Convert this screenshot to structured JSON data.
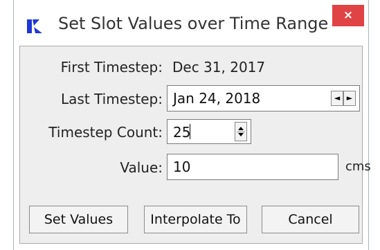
{
  "window": {
    "title": "Set Slot Values over Time Range",
    "close_symbol": "×",
    "icon": "riverware-r-icon",
    "accent_color": "#1f37d6",
    "close_color": "#e04343"
  },
  "form": {
    "first_timestep": {
      "label": "First Timestep:",
      "value": "Dec 31, 2017"
    },
    "last_timestep": {
      "label": "Last Timestep:",
      "value": "Jan 24, 2018",
      "prev_symbol": "◄",
      "next_symbol": "►"
    },
    "timestep_count": {
      "label": "Timestep Count:",
      "value": "25"
    },
    "value": {
      "label": "Value:",
      "value": "10",
      "unit": "cms"
    }
  },
  "buttons": {
    "set_values": "Set Values",
    "interpolate_to": "Interpolate To",
    "cancel": "Cancel"
  }
}
